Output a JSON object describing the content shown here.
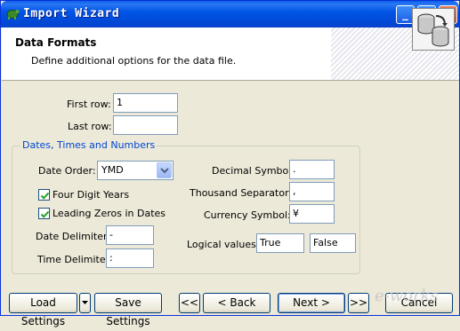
{
  "window": {
    "title": "Import Wizard"
  },
  "header": {
    "title": "Data Formats",
    "subtitle": "Define additional options for the data file."
  },
  "rows": {
    "first_row_label": "First row:",
    "first_row_value": "1",
    "last_row_label": "Last row:",
    "last_row_value": ""
  },
  "group": {
    "title": "Dates, Times and Numbers",
    "date_order_label": "Date Order:",
    "date_order_value": "YMD",
    "four_digit_years_label": "Four Digit Years",
    "four_digit_years_checked": true,
    "leading_zeros_label": "Leading Zeros in Dates",
    "leading_zeros_checked": true,
    "date_delimiter_label": "Date Delimiter:",
    "date_delimiter_value": "-",
    "time_delimiter_label": "Time Delimiter:",
    "time_delimiter_value": ":",
    "decimal_symbol_label": "Decimal Symbol:",
    "decimal_symbol_value": ".",
    "thousand_separator_label": "Thousand Separator:",
    "thousand_separator_value": ",",
    "currency_symbol_label": "Currency Symbol:",
    "currency_symbol_value": "¥",
    "logical_values_label": "Logical values:",
    "logical_true_value": "True",
    "logical_false_value": "False"
  },
  "footer": {
    "load_settings": "Load Settings",
    "save_settings": "Save Settings",
    "first": "<<",
    "back": "< Back",
    "next": "Next >",
    "last": ">>",
    "cancel": "Cancel"
  },
  "watermark": "e-works",
  "colors": {
    "titlebar": "#0055e5",
    "group_title": "#0046d5",
    "background": "#ece9d8"
  },
  "icons": {
    "app": "turtle-icon",
    "header": "database-convert-icon"
  }
}
